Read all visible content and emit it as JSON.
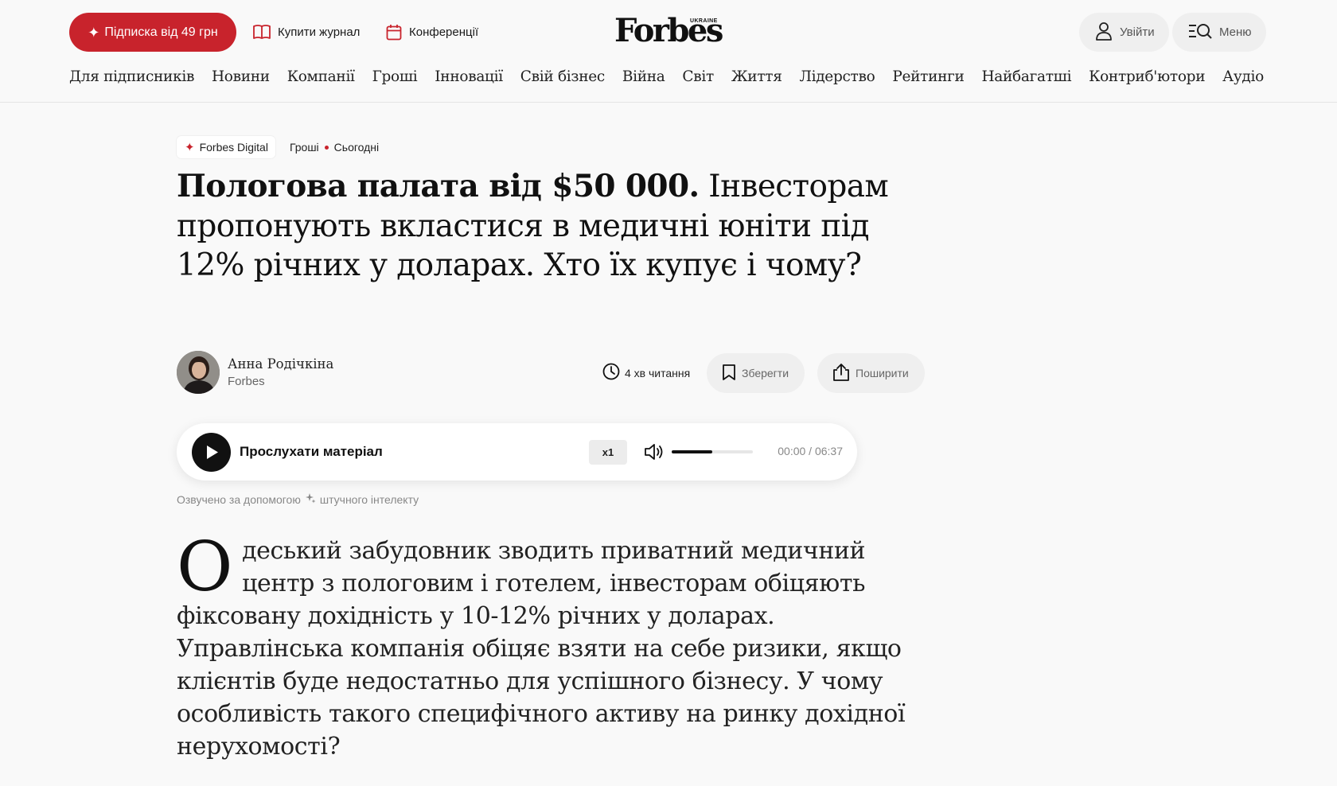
{
  "header": {
    "subscribe_label": "Підписка від 49 грн",
    "buy_magazine": "Купити журнал",
    "conferences": "Конференції",
    "logo": "Forbes",
    "logo_sub": "UKRAINE",
    "login": "Увійти",
    "menu": "Меню",
    "accent_color": "#c8232c"
  },
  "nav": [
    "Для підписників",
    "Новини",
    "Компанії",
    "Гроші",
    "Інновації",
    "Свій бізнес",
    "Війна",
    "Світ",
    "Життя",
    "Лідерство",
    "Рейтинги",
    "Найбагатші",
    "Контриб'ютори",
    "Аудіо"
  ],
  "article": {
    "tag": "Forbes Digital",
    "category": "Гроші",
    "date": "Сьогодні",
    "title_bold": "Пологова палата від $50 000.",
    "title_rest": " Інвесторам пропонують вкластися в медичні юніти під 12% річних у доларах. Хто їх купує і чому?",
    "author_name": "Анна Родічкіна",
    "author_org": "Forbes",
    "read_time": "4 хв читання",
    "save": "Зберегти",
    "share": "Поширити",
    "lead_initial": "О",
    "lead_text": "деський забудовник зводить приватний медичний центр з пологовим і готелем, інвесторам обіцяють фіксовану дохідність у 10-12% річних у доларах. Управлінська компанія обіцяє взяти на себе ризики, якщо клієнтів буде недостатньо для успішного бізнесу. У чому особливість такого специфічного активу на ринку дохідної нерухомості?"
  },
  "player": {
    "title": "Прослухати матеріал",
    "speed": "x1",
    "volume_level": 0.5,
    "time": "00:00 / 06:37",
    "ai_note_before": "Озвучено за допомогою",
    "ai_note_after": "штучного інтелекту"
  }
}
